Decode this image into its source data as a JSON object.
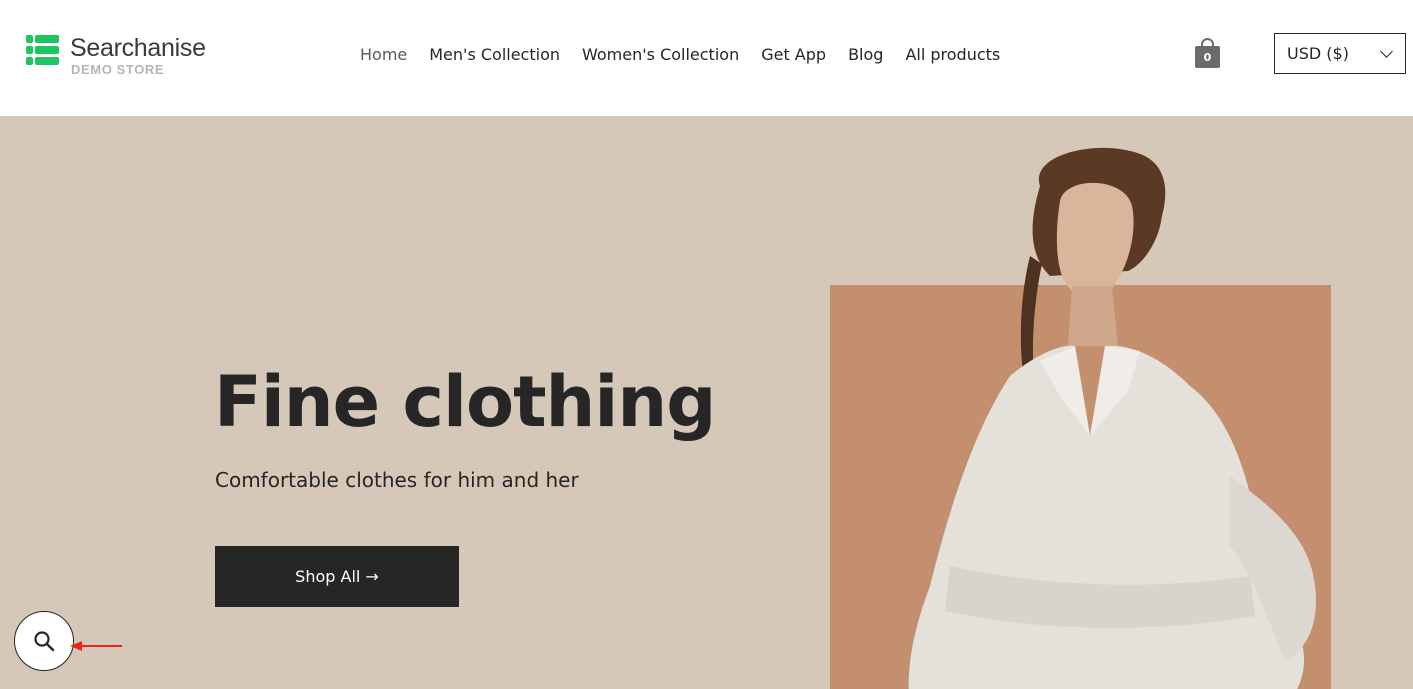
{
  "header": {
    "logo": {
      "name": "Searchanise",
      "subtitle": "DEMO STORE"
    },
    "nav": [
      {
        "label": "Home",
        "active": true
      },
      {
        "label": "Men's Collection",
        "active": false
      },
      {
        "label": "Women's Collection",
        "active": false
      },
      {
        "label": "Get App",
        "active": false
      },
      {
        "label": "Blog",
        "active": false
      },
      {
        "label": "All products",
        "active": false
      }
    ],
    "cart": {
      "icon": "shopping-bag-icon",
      "count": "0"
    },
    "currency": {
      "selected": "USD ($)",
      "icon": "chevron-down-icon"
    }
  },
  "hero": {
    "title": "Fine clothing",
    "subtitle": "Comfortable clothes for him and her",
    "button_label": "Shop All →",
    "background_color": "#d6c8b8",
    "accent_block_color": "#c48f6e"
  },
  "search_fab": {
    "icon": "search-icon"
  },
  "colors": {
    "brand_green": "#1fc660",
    "dark": "#262626",
    "annotation": "#e8251a"
  }
}
